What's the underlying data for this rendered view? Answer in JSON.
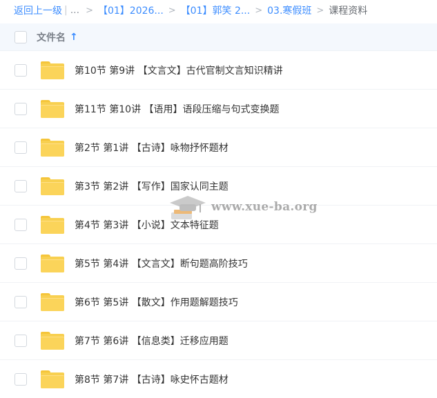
{
  "breadcrumb": {
    "back": "返回上一级",
    "separator": "|",
    "ellipsis": "...",
    "arrow": ">",
    "crumb1": "【01】2026...",
    "crumb2": "【01】郭笑 2...",
    "crumb3": "03.寒假班",
    "current": "课程资料"
  },
  "header": {
    "column_label": "文件名",
    "sort_icon": "↑"
  },
  "files": [
    "第10节 第9讲 【文言文】古代官制文言知识精讲",
    "第11节 第10讲 【语用】语段压缩与句式变换题",
    "第2节 第1讲 【古诗】咏物抒怀题材",
    "第3节 第2讲 【写作】国家认同主题",
    "第4节 第3讲 【小说】文本特征题",
    "第5节 第4讲 【文言文】断句题高阶技巧",
    "第6节 第5讲 【散文】作用题解题技巧",
    "第7节 第6讲 【信息类】迁移应用题",
    "第8节 第7讲 【古诗】咏史怀古题材"
  ],
  "watermark": {
    "text": "www.xue-ba.org"
  },
  "colors": {
    "accent": "#3b8cff",
    "folder": "#f8d050",
    "header_bg": "#f4f8fd"
  }
}
